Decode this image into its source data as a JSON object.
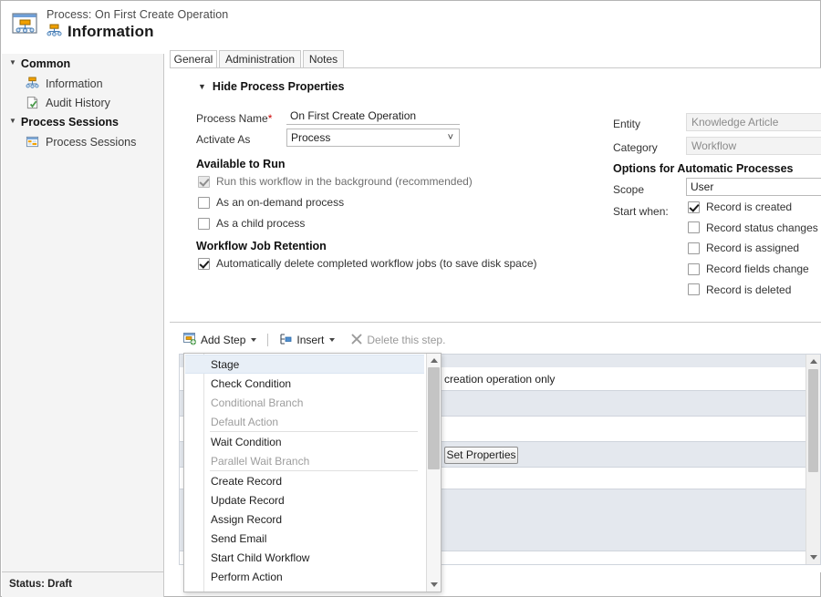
{
  "header": {
    "subtitle": "Process: On First Create Operation",
    "title": "Information",
    "window_icon": "process-window-icon",
    "title_icon": "process-icon"
  },
  "sidebar": {
    "groups": [
      {
        "label": "Common",
        "items": [
          {
            "label": "Information",
            "icon": "process-icon"
          },
          {
            "label": "Audit History",
            "icon": "audit-page-icon"
          }
        ]
      },
      {
        "label": "Process Sessions",
        "items": [
          {
            "label": "Process Sessions",
            "icon": "grid-window-icon"
          }
        ]
      }
    ]
  },
  "statusbar": {
    "text": "Status: Draft"
  },
  "tabs": [
    {
      "label": "General",
      "selected": true
    },
    {
      "label": "Administration",
      "selected": false
    },
    {
      "label": "Notes",
      "selected": false
    }
  ],
  "general": {
    "section_toggle": "Hide Process Properties",
    "process_name_label": "Process Name",
    "process_name_required": "*",
    "process_name_value": "On First Create Operation",
    "activate_as_label": "Activate As",
    "activate_as_value": "Process",
    "available_to_run_heading": "Available to Run",
    "available_to_run": [
      {
        "label": "Run this workflow in the background (recommended)",
        "checked": true,
        "disabled": true
      },
      {
        "label": "As an on-demand process",
        "checked": false,
        "disabled": false
      },
      {
        "label": "As a child process",
        "checked": false,
        "disabled": false
      }
    ],
    "retention_heading": "Workflow Job Retention",
    "retention": [
      {
        "label": "Automatically delete completed workflow jobs (to save disk space)",
        "checked": true,
        "disabled": false
      }
    ],
    "entity_label": "Entity",
    "entity_value": "Knowledge Article",
    "category_label": "Category",
    "category_value": "Workflow",
    "automatic_heading": "Options for Automatic Processes",
    "scope_label": "Scope",
    "scope_value": "User",
    "start_when_label": "Start when:",
    "start_when": [
      {
        "label": "Record is created",
        "checked": true,
        "has_button": false
      },
      {
        "label": "Record status changes",
        "checked": false,
        "has_button": false
      },
      {
        "label": "Record is assigned",
        "checked": false,
        "has_button": false
      },
      {
        "label": "Record fields change",
        "checked": false,
        "has_button": true
      },
      {
        "label": "Record is deleted",
        "checked": false,
        "has_button": false
      }
    ]
  },
  "steps_toolbar": {
    "add_step": {
      "label": "Add Step",
      "icon": "add-step-icon",
      "has_dropdown": true
    },
    "insert": {
      "label": "Insert",
      "icon": "insert-icon",
      "has_dropdown": true
    },
    "delete": {
      "label": "Delete this step.",
      "icon": "delete-x-icon",
      "disabled": true
    }
  },
  "designer": {
    "row_text": "creation operation only",
    "set_properties_label": "Set Properties"
  },
  "add_step_menu": {
    "items": [
      {
        "label": "Stage",
        "disabled": false,
        "selected": true,
        "separator_after": false
      },
      {
        "label": "Check Condition",
        "disabled": false,
        "selected": false,
        "separator_after": false
      },
      {
        "label": "Conditional Branch",
        "disabled": true,
        "selected": false,
        "separator_after": false
      },
      {
        "label": "Default Action",
        "disabled": true,
        "selected": false,
        "separator_after": true
      },
      {
        "label": "Wait Condition",
        "disabled": false,
        "selected": false,
        "separator_after": false
      },
      {
        "label": "Parallel Wait Branch",
        "disabled": true,
        "selected": false,
        "separator_after": true
      },
      {
        "label": "Create Record",
        "disabled": false,
        "selected": false,
        "separator_after": false
      },
      {
        "label": "Update Record",
        "disabled": false,
        "selected": false,
        "separator_after": false
      },
      {
        "label": "Assign Record",
        "disabled": false,
        "selected": false,
        "separator_after": false
      },
      {
        "label": "Send Email",
        "disabled": false,
        "selected": false,
        "separator_after": false
      },
      {
        "label": "Start Child Workflow",
        "disabled": false,
        "selected": false,
        "separator_after": false
      },
      {
        "label": "Perform Action",
        "disabled": false,
        "selected": false,
        "separator_after": false
      }
    ]
  },
  "colors": {
    "accent": "#e8eff7",
    "panel": "#e4e8ee",
    "nav_bg": "#f4f4f4",
    "required": "#cc0000"
  }
}
